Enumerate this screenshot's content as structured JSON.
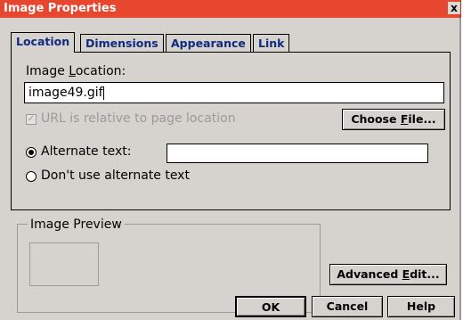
{
  "window": {
    "title": "Image Properties",
    "close_glyph": "x"
  },
  "tabs": [
    {
      "label": "Location",
      "active": true
    },
    {
      "label": "Dimensions",
      "active": false
    },
    {
      "label": "Appearance",
      "active": false
    },
    {
      "label": "Link",
      "active": false
    }
  ],
  "location": {
    "image_location_label_pre": "Image ",
    "image_location_label_u": "L",
    "image_location_label_post": "ocation:",
    "image_location_value": "image49.gif",
    "url_relative_label": "URL is relative to page location",
    "url_relative_checked": true,
    "url_relative_disabled": true,
    "choose_file_pre": "Choose ",
    "choose_file_u": "F",
    "choose_file_post": "ile...",
    "alternate_text_label": "Alternate text:",
    "alternate_text_value": "",
    "alternate_text_selected": true,
    "dont_use_alt_label": "Don't use alternate text",
    "dont_use_alt_selected": false
  },
  "preview": {
    "group_title": "Image Preview"
  },
  "buttons": {
    "advanced_edit_pre": "Advanced ",
    "advanced_edit_u": "E",
    "advanced_edit_post": "dit...",
    "ok": "OK",
    "cancel": "Cancel",
    "help": "Help"
  },
  "colors": {
    "titlebar": "#e8472f",
    "dialog_bg": "#d6d3ce",
    "tab_text": "#102a80"
  },
  "icons": {
    "close": "close-icon",
    "checkbox": "checkbox-icon",
    "radio": "radio-icon"
  }
}
